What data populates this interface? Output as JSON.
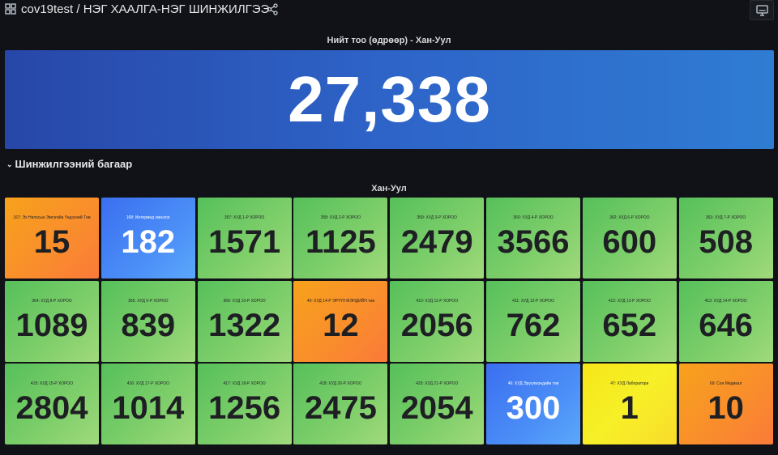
{
  "header": {
    "breadcrumb": "cov19test / НЭГ ХААЛГА-НЭГ ШИНЖИЛГЭЭ",
    "icons": {
      "apps": "apps-grid-icon",
      "share": "share-icon",
      "tv": "tv-monitor-icon"
    }
  },
  "total_panel": {
    "title": "Нийт тоо (өдрөөр) - Хан-Уул",
    "value": "27,338"
  },
  "row": {
    "chevron": "⌄",
    "title": "Шинжилгээний багаар"
  },
  "grid_panel": {
    "title": "Хан-Уул",
    "tiles": [
      {
        "label": "167: Эх Нялхсын Эмгэгийн Үндэсний Төв",
        "value": "15",
        "color": "orange"
      },
      {
        "label": "168: Интермед эмнэлэг",
        "value": "182",
        "color": "blue"
      },
      {
        "label": "357: ХУД 1-Р ХОРОО",
        "value": "1571",
        "color": "green"
      },
      {
        "label": "358: ХУД 2-Р ХОРОО",
        "value": "1125",
        "color": "green"
      },
      {
        "label": "359: ХУД 3-Р ХОРОО",
        "value": "2479",
        "color": "green"
      },
      {
        "label": "360: ХУД 4-Р ХОРОО",
        "value": "3566",
        "color": "green"
      },
      {
        "label": "362: ХУД 6-Р ХОРОО",
        "value": "600",
        "color": "green"
      },
      {
        "label": "363: ХУД 7-Р ХОРОО",
        "value": "508",
        "color": "green"
      },
      {
        "label": "364: ХУД 8-Р ХОРОО",
        "value": "1089",
        "color": "green"
      },
      {
        "label": "365: ХУД 9-Р ХОРОО",
        "value": "839",
        "color": "green"
      },
      {
        "label": "366: ХУД 10-Р ХОРОО",
        "value": "1322",
        "color": "green"
      },
      {
        "label": "40: ХУД 14-Р ЭРҮҮЛ МЭНДИЙН төв",
        "value": "12",
        "color": "orange"
      },
      {
        "label": "410: ХУД 11-Р ХОРОО",
        "value": "2056",
        "color": "green"
      },
      {
        "label": "411: ХУД 12-Р ХОРОО",
        "value": "762",
        "color": "green"
      },
      {
        "label": "412: ХУД 13-Р ХОРОО",
        "value": "652",
        "color": "green"
      },
      {
        "label": "413: ХУД 14-Р ХОРОО",
        "value": "646",
        "color": "green"
      },
      {
        "label": "415: ХУД 15-Р ХОРОО",
        "value": "2804",
        "color": "green"
      },
      {
        "label": "416: ХУД 17-Р ХОРОО",
        "value": "1014",
        "color": "green"
      },
      {
        "label": "417: ХУД 18-Р ХОРОО",
        "value": "1256",
        "color": "green"
      },
      {
        "label": "418: ХУД 20-Р ХОРОО",
        "value": "2475",
        "color": "green"
      },
      {
        "label": "420: ХУД 21-Р ХОРОО",
        "value": "2054",
        "color": "green"
      },
      {
        "label": "46: ХУД Эрүүлмэндийн төв",
        "value": "300",
        "color": "blue"
      },
      {
        "label": "47: ХУД Лаборатори",
        "value": "1",
        "color": "yellow"
      },
      {
        "label": "69: Сон Медикал",
        "value": "10",
        "color": "orange"
      }
    ]
  }
}
